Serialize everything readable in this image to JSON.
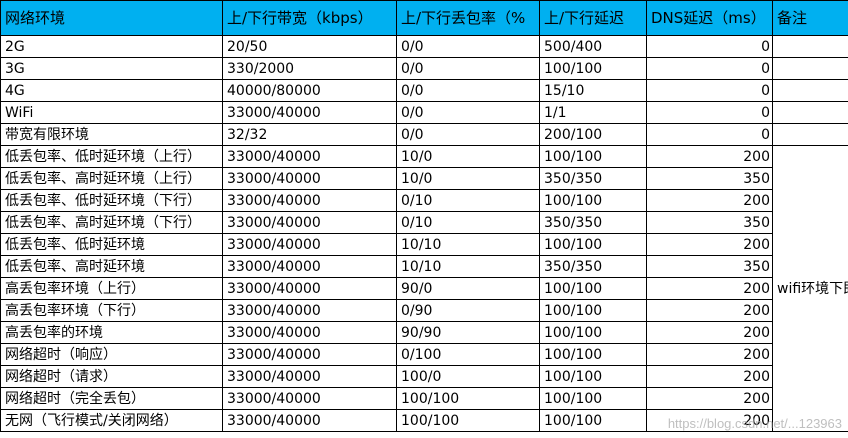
{
  "header": {
    "col1": "网络环境",
    "col2": "上/下行带宽（kbps）",
    "col3": "上/下行丢包率（%",
    "col4": "上/下行延迟",
    "col5": "DNS延迟（ms）",
    "col6": "备注"
  },
  "rows": [
    {
      "env": "2G",
      "bw": "20/50",
      "loss": "0/0",
      "latency": "500/400",
      "dns": "0"
    },
    {
      "env": "3G",
      "bw": "330/2000",
      "loss": "0/0",
      "latency": "100/100",
      "dns": "0"
    },
    {
      "env": "4G",
      "bw": "40000/80000",
      "loss": "0/0",
      "latency": "15/10",
      "dns": "0"
    },
    {
      "env": "WiFi",
      "bw": "33000/40000",
      "loss": "0/0",
      "latency": "1/1",
      "dns": "0"
    },
    {
      "env": "带宽有限环境",
      "bw": "32/32",
      "loss": "0/0",
      "latency": "200/100",
      "dns": "0"
    },
    {
      "env": "低丢包率、低时延环境（上行）",
      "bw": "33000/40000",
      "loss": "10/0",
      "latency": "100/100",
      "dns": "200"
    },
    {
      "env": "低丢包率、高时延环境（上行）",
      "bw": "33000/40000",
      "loss": "10/0",
      "latency": "350/350",
      "dns": "350"
    },
    {
      "env": "低丢包率、低时延环境（下行）",
      "bw": "33000/40000",
      "loss": "0/10",
      "latency": "100/100",
      "dns": "200"
    },
    {
      "env": "低丢包率、高时延环境（下行）",
      "bw": "33000/40000",
      "loss": "0/10",
      "latency": "350/350",
      "dns": "350"
    },
    {
      "env": "低丢包率、低时延环境",
      "bw": "33000/40000",
      "loss": "10/10",
      "latency": "100/100",
      "dns": "200"
    },
    {
      "env": "低丢包率、高时延环境",
      "bw": "33000/40000",
      "loss": "10/10",
      "latency": "350/350",
      "dns": "350"
    },
    {
      "env": "高丢包率环境（上行）",
      "bw": "33000/40000",
      "loss": "90/0",
      "latency": "100/100",
      "dns": "200"
    },
    {
      "env": "高丢包率环境（下行）",
      "bw": "33000/40000",
      "loss": "0/90",
      "latency": "100/100",
      "dns": "200"
    },
    {
      "env": "高丢包率的环境",
      "bw": "33000/40000",
      "loss": "90/90",
      "latency": "100/100",
      "dns": "200"
    },
    {
      "env": "网络超时（响应）",
      "bw": "33000/40000",
      "loss": "0/100",
      "latency": "100/100",
      "dns": "200"
    },
    {
      "env": "网络超时（请求）",
      "bw": "33000/40000",
      "loss": "100/0",
      "latency": "100/100",
      "dns": "200"
    },
    {
      "env": "网络超时（完全丢包）",
      "bw": "33000/40000",
      "loss": "100/100",
      "latency": "100/100",
      "dns": "200"
    },
    {
      "env": "无网（飞行模式/关闭网络）",
      "bw": "33000/40000",
      "loss": "100/100",
      "latency": "100/100",
      "dns": "200"
    }
  ],
  "note": "wifi环境下即可设置",
  "watermark": "https://blog.csdn.net/...123963"
}
